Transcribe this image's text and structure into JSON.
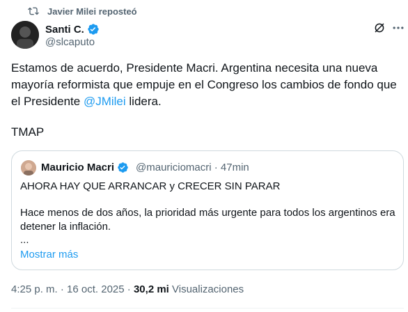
{
  "repost": {
    "label": "Javier Milei reposteó",
    "icon": "repost-icon"
  },
  "author": {
    "name": "Santi C.",
    "handle": "@slcaputo",
    "verified": true
  },
  "tweet": {
    "text_before": "Estamos de acuerdo, Presidente Macri. Argentina necesita una nueva mayoría reformista que empuje en el Congreso los cambios de fondo que el Presidente ",
    "mention": "@JMilei",
    "text_after": " lidera.",
    "sign": "TMAP"
  },
  "quote": {
    "name": "Mauricio Macri",
    "handle": "@mauriciomacri",
    "separator": "·",
    "time": "47min",
    "line1": "AHORA HAY QUE ARRANCAR y CRECER SIN PARAR",
    "paragraph": "Hace menos de dos años, la prioridad más urgente para todos los argentinos era detener la inflación.",
    "ellipsis": "...",
    "show_more": "Mostrar más"
  },
  "meta": {
    "time": "4:25 p. m.",
    "sep": "·",
    "date": "16 oct. 2025",
    "sep2": "·",
    "views": "30,2 mi",
    "views_label": "Visualizaciones"
  },
  "colors": {
    "accent": "#1d9bf0",
    "muted": "#536471",
    "text": "#0f1419"
  }
}
